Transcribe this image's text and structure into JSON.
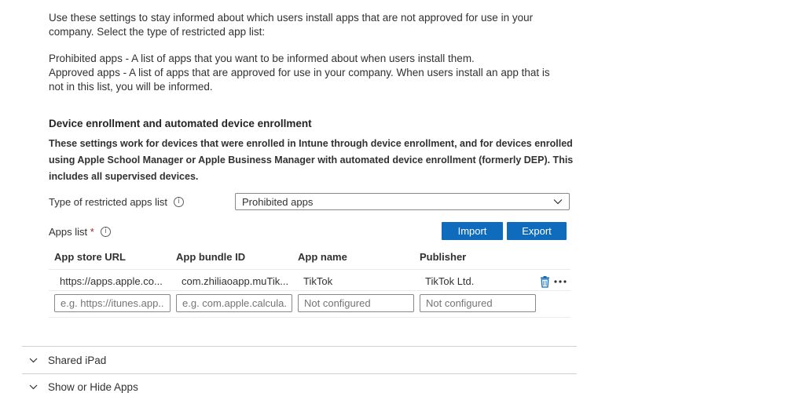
{
  "intro": {
    "line1": "Use these settings to stay informed about which users install apps that are not approved for use in your company. Select the type of restricted app list:",
    "prohibited": "Prohibited apps - A list of apps that you want to be informed about when users install them.",
    "approved": "Approved apps - A list of apps that are approved for use in your company. When users install an app that is not in this list, you will be informed."
  },
  "section": {
    "title": "Device enrollment and automated device enrollment",
    "description": "These settings work for devices that were enrolled in Intune through device enrollment, and for devices enrolled using Apple School Manager or Apple Business Manager with automated device enrollment (formerly DEP). This includes all supervised devices."
  },
  "restricted_type": {
    "label": "Type of restricted apps list",
    "value": "Prohibited apps"
  },
  "apps_list": {
    "label": "Apps list",
    "required_mark": "*",
    "import_label": "Import",
    "export_label": "Export",
    "columns": [
      "App store URL",
      "App bundle ID",
      "App name",
      "Publisher"
    ],
    "rows": [
      {
        "url": "https://apps.apple.co...",
        "bundle": "com.zhiliaoapp.muTik...",
        "name": "TikTok",
        "publisher": "TikTok Ltd."
      }
    ],
    "placeholders": {
      "url": "e.g. https://itunes.app...",
      "bundle": "e.g. com.apple.calcula...",
      "name": "Not configured",
      "publisher": "Not configured"
    }
  },
  "sections_collapsed": [
    "Shared iPad",
    "Show or Hide Apps"
  ],
  "colors": {
    "accent": "#0f6cbd",
    "delete_icon": "#0f6cbd"
  },
  "icons": [
    "info-icon",
    "chevron-down-icon",
    "trash-icon",
    "more-icon"
  ]
}
